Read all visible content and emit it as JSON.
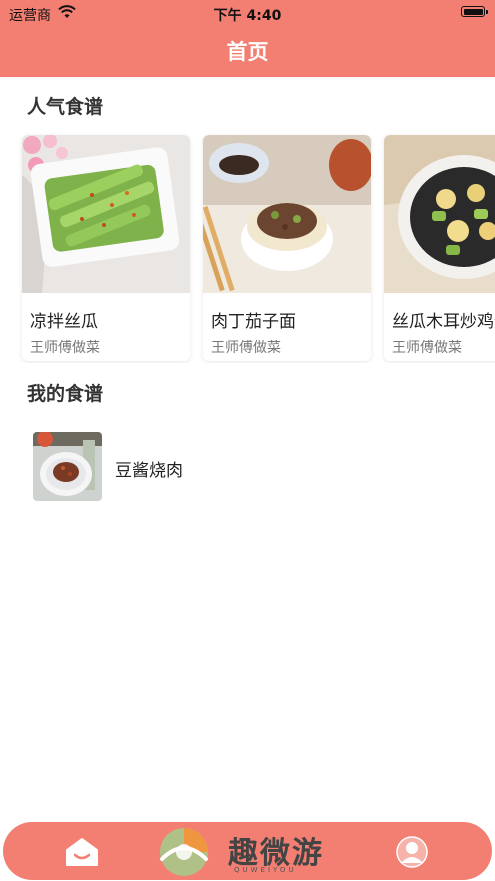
{
  "status_bar": {
    "carrier": "运营商",
    "time": "下午 4:40"
  },
  "nav": {
    "title": "首页"
  },
  "popular": {
    "heading": "人气食谱",
    "items": [
      {
        "name": "凉拌丝瓜",
        "author": "王师傅做菜"
      },
      {
        "name": "肉丁茄子面",
        "author": "王师傅做菜"
      },
      {
        "name": "丝瓜木耳炒鸡蛋",
        "author": "王师傅做菜"
      }
    ]
  },
  "mine": {
    "heading": "我的食谱",
    "items": [
      {
        "name": "豆酱烧肉"
      }
    ]
  },
  "watermark": {
    "text": "趣微游",
    "sub": "QUWEIYOU"
  },
  "colors": {
    "accent": "#f27f72"
  },
  "icons": {
    "wifi": "wifi-icon",
    "battery": "battery-icon",
    "home": "home-icon",
    "profile": "profile-icon"
  }
}
